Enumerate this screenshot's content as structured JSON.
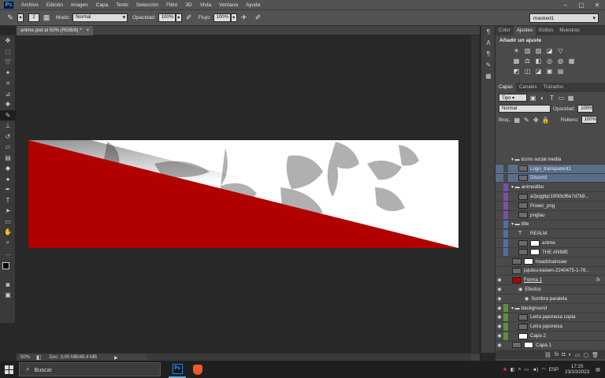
{
  "menubar": {
    "logo": "Ps",
    "items": [
      "Archivo",
      "Edición",
      "Imagen",
      "Capa",
      "Texto",
      "Selección",
      "Filtro",
      "3D",
      "Vista",
      "Ventana",
      "Ayuda"
    ]
  },
  "options": {
    "brush_size": "2",
    "mode_label": "Modo:",
    "mode_value": "Normal",
    "opacity_label": "Opacidad:",
    "opacity_value": "100%",
    "flow_label": "Flujo:",
    "flow_value": "100%",
    "workspace": "masked1"
  },
  "document": {
    "tab_title": "anime.psd al 50% (RGB/8) *",
    "zoom": "50%",
    "doc_info": "Doc: 3,00 MB/49,4 MB",
    "colors": {
      "red": "#b00000",
      "white": "#ffffff"
    }
  },
  "adjust_panel": {
    "tabs": [
      "Color",
      "Ajustes",
      "Estilos",
      "Muestras"
    ],
    "active_tab": "Ajustes",
    "title": "Añadir un ajuste"
  },
  "layers_panel": {
    "tabs": [
      "Capas",
      "Canales",
      "Trazados"
    ],
    "active_tab": "Capas",
    "filter": "Tipo",
    "blend": "Normal",
    "opacity_label": "Opacidad:",
    "opacity_value": "100%",
    "lock_label": "Bloq.:",
    "fill_label": "Relleno:",
    "fill_value": "100%",
    "layers": [
      {
        "name": "icons social media",
        "kind": "group",
        "indent": 0,
        "color": "#4a4a4a",
        "eye": false
      },
      {
        "name": "Logo_transparent1",
        "kind": "smart",
        "indent": 1,
        "color": "#4a4a4a",
        "eye": false,
        "selected": true
      },
      {
        "name": "Discord",
        "kind": "smart",
        "indent": 1,
        "color": "#4a4a4a",
        "eye": false,
        "selected": true
      },
      {
        "name": "animedibu",
        "kind": "group",
        "indent": 0,
        "color": "#7a4fb0",
        "eye": false
      },
      {
        "name": "a2pqgtqc190l3cf6e7d7b9...",
        "kind": "smart",
        "indent": 1,
        "color": "#7a4fb0",
        "eye": false
      },
      {
        "name": "Power_png",
        "kind": "smart",
        "indent": 1,
        "color": "#7a4fb0",
        "eye": false
      },
      {
        "name": "pnglau",
        "kind": "smart",
        "indent": 1,
        "color": "#7a4fb0",
        "eye": false
      },
      {
        "name": "title",
        "kind": "group",
        "indent": 0,
        "color": "#4f6fa8",
        "eye": false
      },
      {
        "name": "REALM",
        "kind": "text",
        "indent": 1,
        "color": "#4f6fa8",
        "eye": false
      },
      {
        "name": "anime",
        "kind": "masked",
        "indent": 1,
        "color": "#4f6fa8",
        "eye": false
      },
      {
        "name": "THE ANIME",
        "kind": "masked",
        "indent": 1,
        "color": "#4f6fa8",
        "eye": false
      },
      {
        "name": "headchainsaw",
        "kind": "masked",
        "indent": 0,
        "color": "#4a4a4a",
        "eye": false
      },
      {
        "name": "jujutsu-kaisen-2240475-1-76...",
        "kind": "smart",
        "indent": 0,
        "color": "#4a4a4a",
        "eye": false
      },
      {
        "name": "Forma 1",
        "kind": "shape",
        "indent": 0,
        "color": "#4a4a4a",
        "eye": true,
        "fx": "fx"
      },
      {
        "name": "Efectos",
        "kind": "effect",
        "indent": 1,
        "color": "#4a4a4a",
        "eye": true
      },
      {
        "name": "Sombra paralela",
        "kind": "effect",
        "indent": 2,
        "color": "#4a4a4a",
        "eye": true
      },
      {
        "name": "background",
        "kind": "group",
        "indent": 0,
        "color": "#5e8f3a",
        "eye": true
      },
      {
        "name": "Letra japonesa copia",
        "kind": "smart",
        "indent": 1,
        "color": "#5e8f3a",
        "eye": true
      },
      {
        "name": "Letra japonesa",
        "kind": "smart",
        "indent": 1,
        "color": "#5e8f3a",
        "eye": true
      },
      {
        "name": "Capa 2",
        "kind": "fill",
        "indent": 1,
        "color": "#5e8f3a",
        "eye": true
      },
      {
        "name": "Capa 1",
        "kind": "masked",
        "indent": 0,
        "color": "#4a4a4a",
        "eye": true
      }
    ]
  },
  "taskbar": {
    "search_placeholder": "Buscar",
    "lang": "ESP",
    "time": "17:20",
    "date": "23/10/2023"
  }
}
